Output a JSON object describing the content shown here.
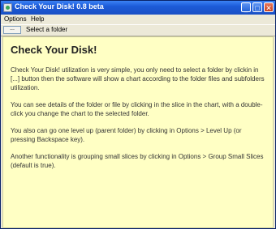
{
  "window": {
    "title": "Check Your Disk! 0.8 beta",
    "minimize": "_",
    "maximize": "□",
    "close": "✕"
  },
  "menu": {
    "options": "Options",
    "help": "Help"
  },
  "toolbar": {
    "browse_label": "...",
    "folder_label": "Select a folder"
  },
  "content": {
    "heading": "Check Your Disk!",
    "paragraphs": [
      "Check Your Disk! utilization is very simple, you only need to select a folder by clickin in [...] button then the software will show a chart according to the folder files and subfolders utilization.",
      "You can see details of the folder or file by clicking in the slice in the chart, with a double-click you change the chart to the selected folder.",
      "You also can go one level up (parent folder) by clicking in Options > Level Up (or pressing Backspace key).",
      "Another functionality is grouping small slices by clicking in Options > Group Small Slices (default is true)."
    ]
  }
}
